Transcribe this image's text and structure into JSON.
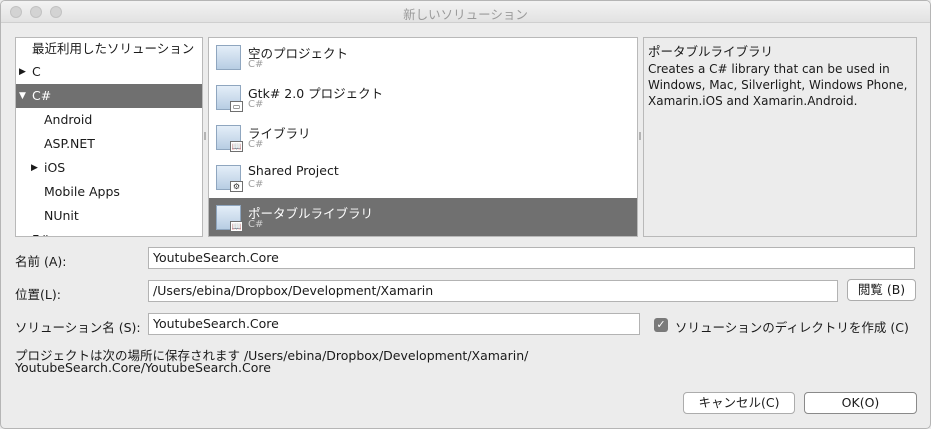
{
  "window": {
    "title": "新しいソリューション"
  },
  "categories": [
    {
      "label": "最近利用したソリューション",
      "arrow": ""
    },
    {
      "label": "C",
      "arrow": "▶"
    },
    {
      "label": "C#",
      "arrow": "▼"
    },
    {
      "label": "Android",
      "arrow": ""
    },
    {
      "label": "ASP.NET",
      "arrow": ""
    },
    {
      "label": "iOS",
      "arrow": "▶"
    },
    {
      "label": "Mobile Apps",
      "arrow": ""
    },
    {
      "label": "NUnit",
      "arrow": ""
    },
    {
      "label": "F#",
      "arrow": "▶"
    }
  ],
  "templates": [
    {
      "name": "空のプロジェクト",
      "lang": "C#",
      "icon": "blank-project-icon",
      "badge": ""
    },
    {
      "name": "Gtk# 2.0 プロジェクト",
      "lang": "C#",
      "icon": "gtk-project-icon",
      "badge": "▭"
    },
    {
      "name": "ライブラリ",
      "lang": "C#",
      "icon": "library-icon",
      "badge": "📖"
    },
    {
      "name": "Shared Project",
      "lang": "C#",
      "icon": "shared-project-icon",
      "badge": "⚙"
    },
    {
      "name": "ポータブルライブラリ",
      "lang": "C#",
      "icon": "portable-library-icon",
      "badge": "📖"
    }
  ],
  "description": {
    "title": "ポータブルライブラリ",
    "text": "Creates a C# library that can be used in Windows, Mac, Silverlight, Windows Phone, Xamarin.iOS and Xamarin.Android."
  },
  "form": {
    "name_label": "名前 (A):",
    "name_value": "YoutubeSearch.Core",
    "location_label": "位置(L):",
    "location_value": "/Users/ebina/Dropbox/Development/Xamarin",
    "browse_label": "閲覧 (B)",
    "solution_label": "ソリューション名 (S):",
    "solution_value": "YoutubeSearch.Core",
    "create_dir_label": "ソリューションのディレクトリを作成 (C)",
    "info_line1": "プロジェクトは次の場所に保存されます /Users/ebina/Dropbox/Development/Xamarin/",
    "info_line2": "YoutubeSearch.Core/YoutubeSearch.Core"
  },
  "buttons": {
    "cancel": "キャンセル(C)",
    "ok": "OK(O)"
  },
  "colors": {
    "selection": "#707070",
    "window_bg": "#ececec"
  }
}
